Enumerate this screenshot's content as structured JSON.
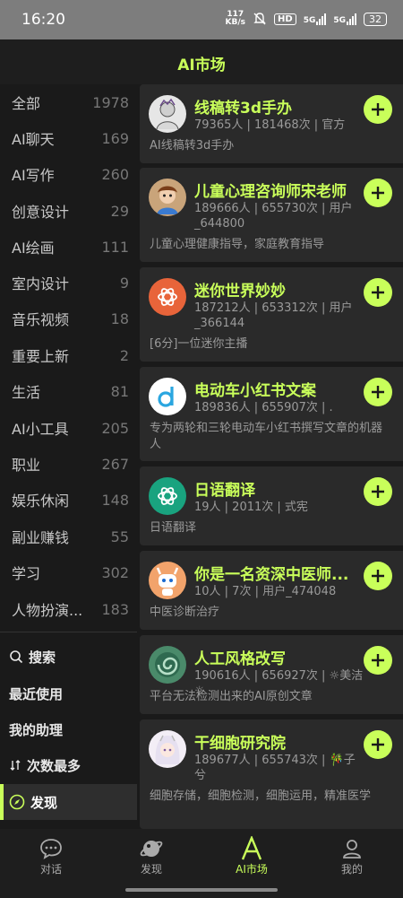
{
  "status": {
    "time": "16:20",
    "net_speed_top": "117",
    "net_speed_bottom": "KB/s",
    "hd_label": "HD",
    "sig1_label": "5G",
    "sig2_label": "5G",
    "battery": "32"
  },
  "header": {
    "title": "AI市场"
  },
  "sidebar": {
    "categories": [
      {
        "label": "全部",
        "count": "1978"
      },
      {
        "label": "AI聊天",
        "count": "169"
      },
      {
        "label": "AI写作",
        "count": "260"
      },
      {
        "label": "创意设计",
        "count": "29"
      },
      {
        "label": "AI绘画",
        "count": "111"
      },
      {
        "label": "室内设计",
        "count": "9"
      },
      {
        "label": "音乐视频",
        "count": "18"
      },
      {
        "label": "重要上新",
        "count": "2"
      },
      {
        "label": "生活",
        "count": "81"
      },
      {
        "label": "AI小工具",
        "count": "205"
      },
      {
        "label": "职业",
        "count": "267"
      },
      {
        "label": "娱乐休闲",
        "count": "148"
      },
      {
        "label": "副业赚钱",
        "count": "55"
      },
      {
        "label": "学习",
        "count": "302"
      },
      {
        "label": "人物扮演...",
        "count": "183"
      }
    ],
    "actions": [
      {
        "label": "搜索",
        "icon": "search-icon"
      },
      {
        "label": "最近使用"
      },
      {
        "label": "我的助理"
      },
      {
        "label": "次数最多",
        "icon": "sort-icon"
      },
      {
        "label": "发现",
        "icon": "compass-icon"
      }
    ]
  },
  "cards": [
    {
      "title": "线稿转3d手办",
      "meta": "79365人 | 181468次 | 官方",
      "desc": "AI线稿转3d手办",
      "avatar": "sketch-figure-avatar"
    },
    {
      "title": "儿童心理咨询师宋老师",
      "meta": "189666人 | 655730次 | 用户_644800",
      "desc": "儿童心理健康指导，家庭教育指导",
      "avatar": "cartoon-teacher-avatar"
    },
    {
      "title": "迷你世界妙妙",
      "meta": "187212人 | 653312次 | 用户_366144",
      "desc": "[6分]一位迷你主播",
      "avatar": "openai-orange-avatar"
    },
    {
      "title": "电动车小红书文案",
      "meta": "189836人 | 655907次 | .",
      "desc": "专为两轮和三轮电动车小红书撰写文章的机器人",
      "avatar": "letter-d-avatar"
    },
    {
      "title": "日语翻译",
      "meta": "19人 | 2011次 | 式宪",
      "desc": "日语翻译",
      "avatar": "openai-green-avatar"
    },
    {
      "title": "你是一名资深中医师...",
      "meta": "10人 | 7次 | 用户_474048",
      "desc": "中医诊断治疗",
      "avatar": "robot-avatar"
    },
    {
      "title": "人工风格改写",
      "meta": "190616人 | 656927次 | ☼美洁☼",
      "desc": "平台无法检测出来的AI原创文章",
      "avatar": "spiral-avatar"
    },
    {
      "title": "干细胞研究院",
      "meta": "189677人 | 655743次 | 🎋子兮",
      "desc": "细胞存储，细胞检测，细胞运用，精准医学",
      "avatar": "anime-girl-avatar"
    }
  ],
  "bottom_nav": [
    {
      "label": "对话",
      "icon": "chat-icon"
    },
    {
      "label": "发现",
      "icon": "planet-icon"
    },
    {
      "label": "AI市场",
      "icon": "letter-a-icon"
    },
    {
      "label": "我的",
      "icon": "person-icon"
    }
  ],
  "colors": {
    "accent": "#c9ff5a",
    "card_bg": "#2a2a2a",
    "page_bg": "#1a1a1a"
  }
}
